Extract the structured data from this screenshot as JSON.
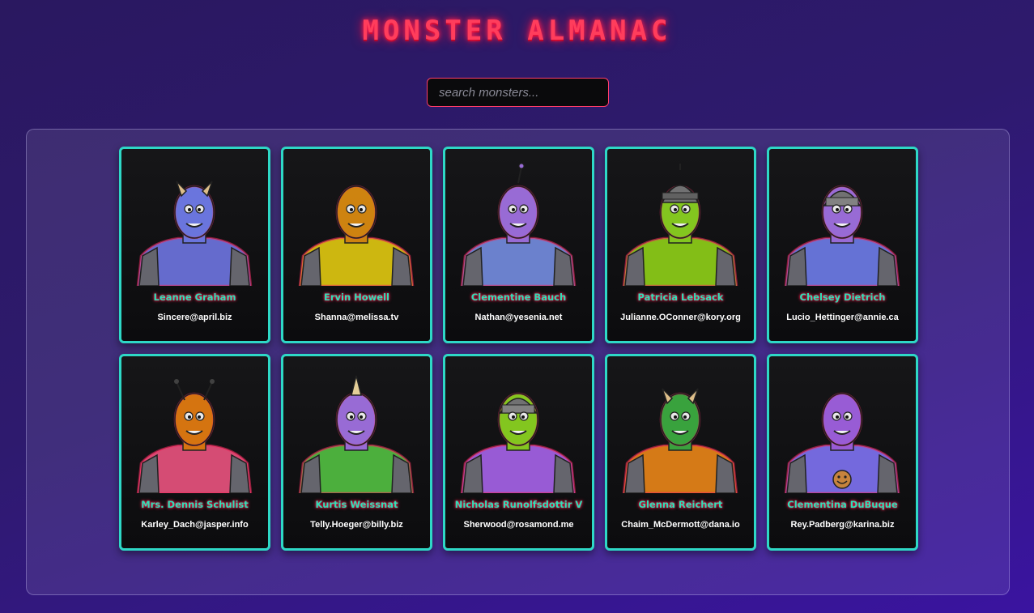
{
  "header": {
    "title": "MONSTER ALMANAC"
  },
  "search": {
    "placeholder": "search monsters...",
    "value": ""
  },
  "monsters": [
    {
      "name": "Leanne Graham",
      "email": "Sincere@april.biz",
      "head": "#6f7be8",
      "body": "#6a70d8",
      "variant": "horns"
    },
    {
      "name": "Ervin Howell",
      "email": "Shanna@melissa.tv",
      "head": "#d98a10",
      "body": "#d8c010",
      "variant": "plain"
    },
    {
      "name": "Clementine Bauch",
      "email": "Nathan@yesenia.net",
      "head": "#a070e0",
      "body": "#7088d8",
      "variant": "antenna"
    },
    {
      "name": "Patricia Lebsack",
      "email": "Julianne.OConner@kory.org",
      "head": "#8ad020",
      "body": "#8ac818",
      "variant": "helmet"
    },
    {
      "name": "Chelsey Dietrich",
      "email": "Lucio_Hettinger@annie.ca",
      "head": "#a070e0",
      "body": "#6a78e0",
      "variant": "visor"
    },
    {
      "name": "Mrs. Dennis Schulist",
      "email": "Karley_Dach@jasper.info",
      "head": "#e07a10",
      "body": "#e0507a",
      "variant": "antennae"
    },
    {
      "name": "Kurtis Weissnat",
      "email": "Telly.Hoeger@billy.biz",
      "head": "#a070e0",
      "body": "#50b840",
      "variant": "unicorn"
    },
    {
      "name": "Nicholas Runolfsdottir V",
      "email": "Sherwood@rosamond.me",
      "head": "#8ad020",
      "body": "#a060e0",
      "variant": "visor"
    },
    {
      "name": "Glenna Reichert",
      "email": "Chaim_McDermott@dana.io",
      "head": "#3caa40",
      "body": "#e08018",
      "variant": "horns"
    },
    {
      "name": "Clementina DuBuque",
      "email": "Rey.Padberg@karina.biz",
      "head": "#a060e0",
      "body": "#7a6ee8",
      "variant": "smiley"
    }
  ],
  "colors": {
    "accent": "#2ed8c6",
    "title": "#ff3d5c",
    "glow": "#ff2050"
  }
}
